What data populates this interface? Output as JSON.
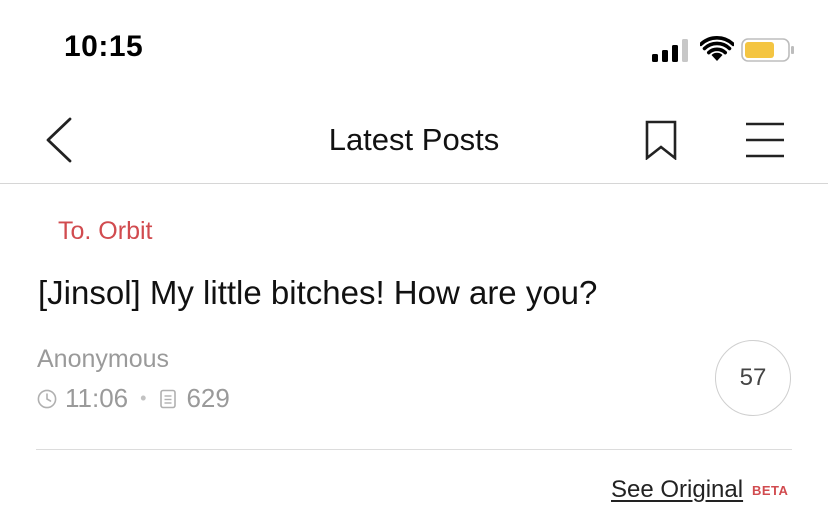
{
  "status_bar": {
    "time": "10:15",
    "signal_icon": "cellular-signal-icon",
    "wifi_icon": "wifi-icon",
    "battery_icon": "battery-icon",
    "battery_color": "#f4c542"
  },
  "nav": {
    "back_icon": "chevron-left-icon",
    "title": "Latest Posts",
    "bookmark_icon": "bookmark-icon",
    "menu_icon": "hamburger-menu-icon"
  },
  "post": {
    "board": "To. Orbit",
    "title": "[Jinsol] My little bitches! How are you?",
    "author": "Anonymous",
    "time": "11:06",
    "views": "629",
    "comment_count": "57"
  },
  "footer": {
    "see_original": "See Original",
    "beta": "BETA"
  },
  "colors": {
    "accent": "#d14b4f",
    "muted_text": "#9a9a9a",
    "divider": "#d6d6d6"
  }
}
